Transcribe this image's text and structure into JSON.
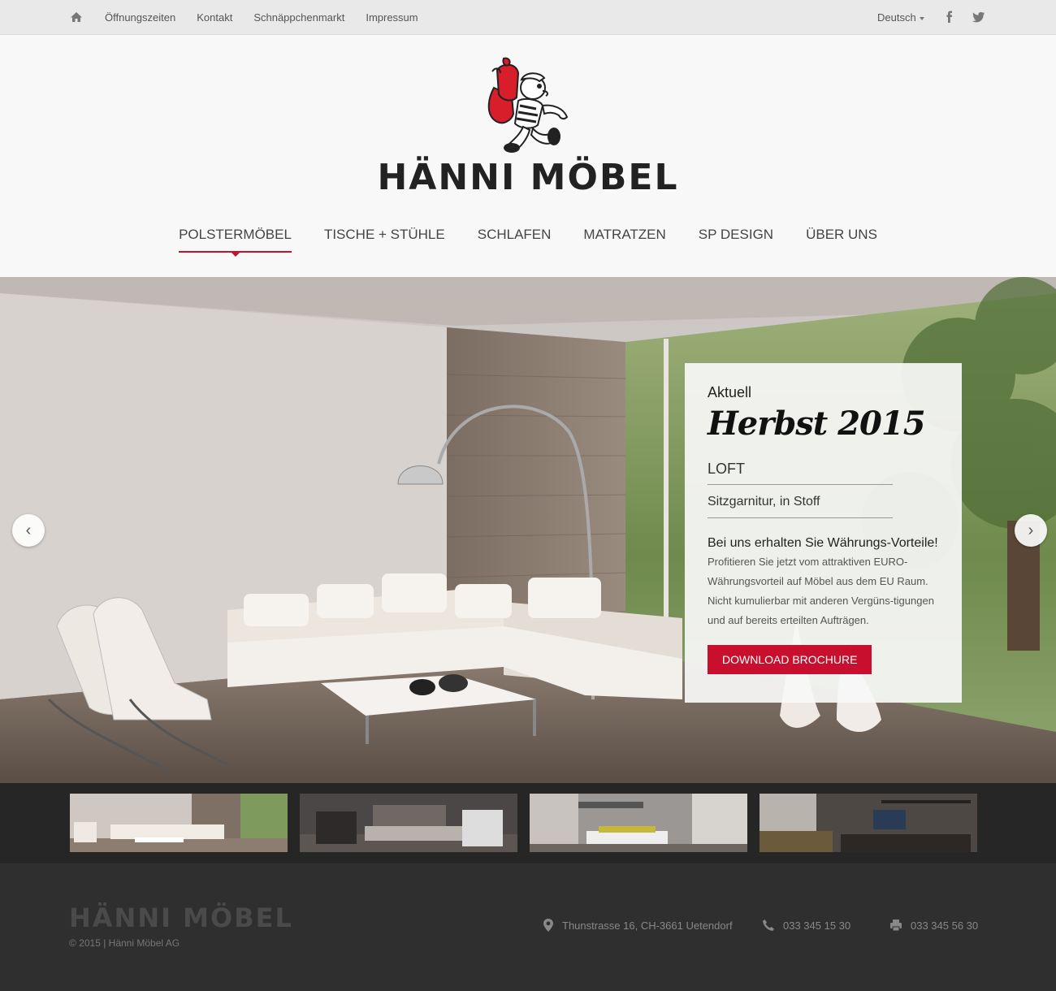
{
  "topbar": {
    "home_icon": "home-icon",
    "links": [
      "Öffnungszeiten",
      "Kontakt",
      "Schnäppchenmarkt",
      "Impressum"
    ],
    "language": "Deutsch",
    "social": [
      {
        "name": "facebook-icon",
        "glyph": "f"
      },
      {
        "name": "twitter-icon",
        "glyph": "t"
      }
    ]
  },
  "header": {
    "brand": "HÄNNI MÖBEL",
    "nav": [
      "POLSTERMÖBEL",
      "TISCHE + STÜHLE",
      "SCHLAFEN",
      "MATRATZEN",
      "SP DESIGN",
      "ÜBER UNS"
    ],
    "active_nav": "POLSTERMÖBEL"
  },
  "hero": {
    "kicker": "Aktuell",
    "season": "Herbst 2015",
    "model": "LOFT",
    "description": "Sitzgarnitur, in Stoff",
    "headline": "Bei uns erhalten Sie Währungs-Vorteile!",
    "body": "Profitieren Sie jetzt vom attraktiven EURO-Währungsvorteil auf Möbel aus dem EU Raum. Nicht kumulierbar mit anderen Vergüns-tigungen und auf bereits erteilten Aufträgen.",
    "button": "DOWNLOAD BROCHURE",
    "prev": "‹",
    "next": "›"
  },
  "thumbnails": 4,
  "footer": {
    "brand": "HÄNNI MÖBEL",
    "copyright": "© 2015 | Hänni Möbel AG",
    "address": "Thunstrasse 16, CH-3661 Uetendorf",
    "phone": "033 345 15 30",
    "fax": "033 345 56 30"
  },
  "colors": {
    "accent": "#c8102e",
    "topbar": "#e9e9e9",
    "footer": "#2f2f2f"
  }
}
